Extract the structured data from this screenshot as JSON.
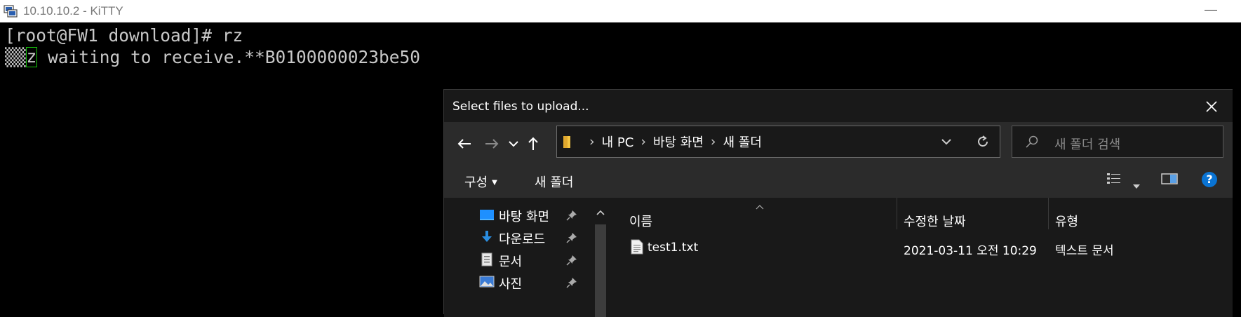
{
  "window": {
    "title": "10.10.10.2 - KiTTY"
  },
  "terminal": {
    "line1": "[root@FW1 download]# rz",
    "line2_prefix": "▒▒",
    "line2_cursor": "z",
    "line2_rest": " waiting to receive.**B0100000023be50"
  },
  "dialog": {
    "title": "Select files to upload...",
    "breadcrumbs": [
      "내 PC",
      "바탕 화면",
      "새 폴더"
    ],
    "search_placeholder": "새 폴더 검색",
    "toolbar": {
      "organize": "구성",
      "new_folder": "새 폴더"
    },
    "help_label": "?",
    "nav_items": [
      {
        "label": "바탕 화면",
        "icon": "desktop-icon"
      },
      {
        "label": "다운로드",
        "icon": "download-icon"
      },
      {
        "label": "문서",
        "icon": "documents-icon"
      },
      {
        "label": "사진",
        "icon": "pictures-icon"
      }
    ],
    "columns": {
      "name": "이름",
      "date": "수정한 날짜",
      "type": "유형"
    },
    "files": [
      {
        "name": "test1.txt",
        "date": "2021-03-11 오전 10:29",
        "type": "텍스트 문서"
      }
    ]
  },
  "colors": {
    "terminal_bg": "#000000",
    "terminal_text": "#c8c8c8",
    "cursor_border": "#16c60c",
    "dialog_bg": "#191919",
    "bar_bg": "#2b2b2b",
    "help_blue": "#0a74d4",
    "folder_yellow": "#f4c542"
  }
}
